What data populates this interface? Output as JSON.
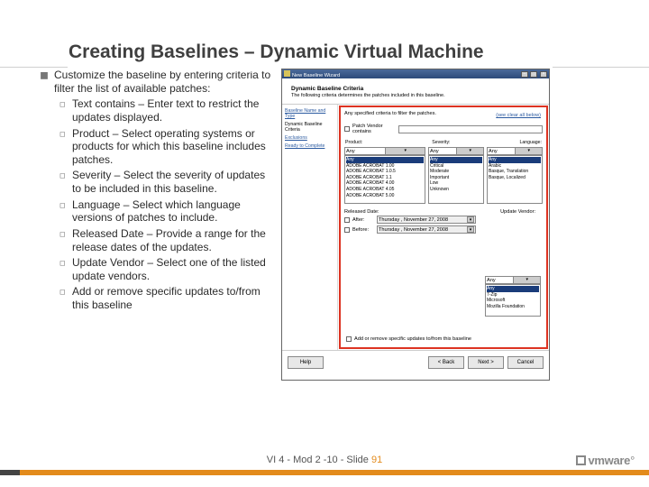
{
  "title": "Creating Baselines – Dynamic Virtual Machine",
  "lead": "Customize the baseline by entering criteria to filter the list of available patches:",
  "subs": [
    "Text contains – Enter text to restrict the updates displayed.",
    "Product – Select operating systems or products for which this baseline includes patches.",
    "Severity – Select the severity of updates to be included in this baseline.",
    "Language – Select which language versions of patches to include.",
    "Released Date – Provide a range for the release dates of the updates.",
    "Update Vendor – Select one of the listed update vendors.",
    "Add or remove specific updates to/from this baseline"
  ],
  "wizard": {
    "title": "New Baseline Wizard",
    "heading": "Dynamic Baseline Criteria",
    "subheading": "The following criteria determines the patches included in this baseline.",
    "nav": [
      "Baseline Name and Type",
      "Dynamic Baseline Criteria",
      "Exclusions",
      "Ready to Complete"
    ],
    "filter_label": "Patch Vendor contains",
    "filter_hint": "Any specified criteria to filter the patches.",
    "clear_all": "(see clear all below)",
    "col_product": "Product:",
    "col_severity": "Severity:",
    "col_language": "Language:",
    "any": "Any",
    "products": [
      "Any",
      "ADOBE ACROBAT 1.00",
      "ADOBE ACROBAT 1.0.5",
      "ADOBE ACROBAT 1.1",
      "ADOBE ACROBAT 4.00",
      "ADOBE ACROBAT 4.05",
      "ADOBE ACROBAT 5.00"
    ],
    "severities": [
      "Any",
      "Critical",
      "Moderate",
      "Important",
      "Low",
      "Unknown"
    ],
    "languages": [
      "Any",
      "Arabic",
      "Basque, Translation",
      "Basque, Localized"
    ],
    "released_label": "Released Date:",
    "vendor_label": "Update Vendor:",
    "after": "After:",
    "before": "Before:",
    "date_sample": "Thursday , November 27, 2008",
    "vendors": [
      "Any",
      "7-Zip",
      "Microsoft",
      "Mozilla Foundation"
    ],
    "addrem": "Add or remove specific updates to/from this baseline",
    "help": "Help",
    "back": "< Back",
    "next": "Next >",
    "cancel": "Cancel"
  },
  "footer": {
    "text": "VI 4 - Mod 2 -10 - Slide",
    "page": "91",
    "brand": "vmware"
  }
}
